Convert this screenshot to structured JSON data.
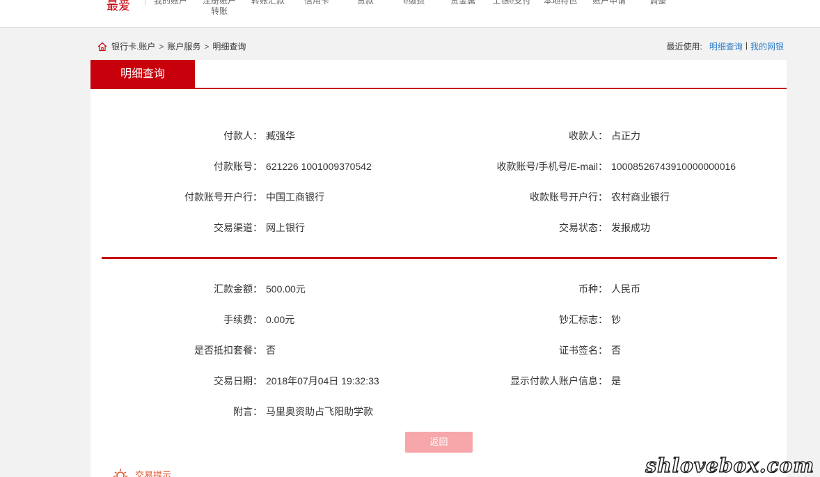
{
  "topnav": {
    "favorite": "最爱",
    "items": [
      {
        "label": "我的账户"
      },
      {
        "label": "注册账户\n转账"
      },
      {
        "label": "转账汇款"
      },
      {
        "label": "信用卡"
      },
      {
        "label": "贷款"
      },
      {
        "label": "e缴费"
      },
      {
        "label": "贵金属"
      },
      {
        "label": "工银e支付"
      },
      {
        "label": "本地特色"
      },
      {
        "label": "账户申请"
      },
      {
        "label": "调整"
      }
    ]
  },
  "breadcrumb": {
    "items": [
      "银行卡.账户",
      "账户服务",
      "明细查询"
    ],
    "separator": ">"
  },
  "recent": {
    "label": "最近使用:",
    "links": [
      "明细查询",
      "我的网银"
    ],
    "separator": "|"
  },
  "panel": {
    "title": "明细查询",
    "accent_color": "#c8000b",
    "section1": [
      {
        "left_label": "付款人：",
        "left_value": "臧强华",
        "right_label": "收款人：",
        "right_value": "占正力"
      },
      {
        "left_label": "付款账号：",
        "left_value": "621226 1001009370542",
        "right_label": "收款账号/手机号/E-mail：",
        "right_value": "10008526743910000000016"
      },
      {
        "left_label": "付款账号开户行：",
        "left_value": "中国工商银行",
        "right_label": "收款账号开户行：",
        "right_value": "农村商业银行"
      },
      {
        "left_label": "交易渠道：",
        "left_value": "网上银行",
        "right_label": "交易状态：",
        "right_value": "发报成功"
      }
    ],
    "section2": [
      {
        "left_label": "汇款金额：",
        "left_value": "500.00元",
        "right_label": "币种：",
        "right_value": "人民币"
      },
      {
        "left_label": "手续费：",
        "left_value": "0.00元",
        "right_label": "钞汇标志：",
        "right_value": "钞"
      },
      {
        "left_label": "是否抵扣套餐：",
        "left_value": "否",
        "right_label": "证书签名：",
        "right_value": "否"
      },
      {
        "left_label": "交易日期：",
        "left_value": "2018年07月04日 19:32:33",
        "right_label": "显示付款人账户信息：",
        "right_value": "是"
      },
      {
        "left_label": "附言：",
        "left_value": "马里奥资助占飞阳助学款",
        "right_label": "",
        "right_value": ""
      }
    ],
    "back_button": "返回"
  },
  "tip": {
    "label": "交易提示",
    "icon": "sun-icon"
  },
  "watermark": "shlovebox.com"
}
